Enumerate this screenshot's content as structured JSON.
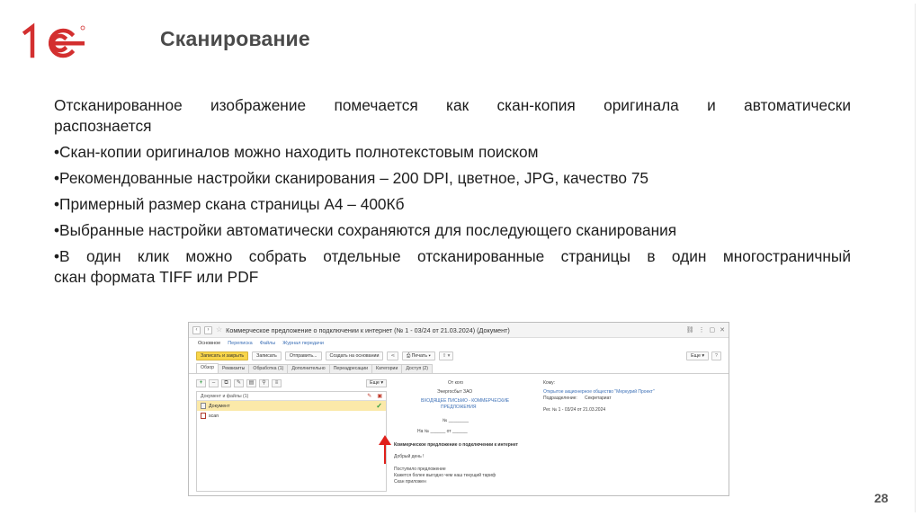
{
  "slide": {
    "title": "Сканирование",
    "page_number": "28",
    "intro": "Отсканированное изображение помечается как скан-копия оригинала и автоматически распознается",
    "intro_line1": "Отсканированное изображение помечается как скан-копия оригинала и автоматически",
    "intro_line2": "распознается",
    "bullets": [
      "•Скан-копии оригиналов можно находить полнотекстовым поиском",
      "•Рекомендованные настройки сканирования – 200 DPI, цветное, JPG, качество 75",
      "•Примерный размер скана страницы А4 – 400Кб",
      "•Выбранные настройки автоматически сохраняются для последующего сканирования"
    ],
    "last_bullet_line1": "•В один клик можно собрать отдельные отсканированные страницы в один многостраничный",
    "last_bullet_line2": "скан формата TIFF или PDF",
    "colors": {
      "title": "#4a4a4a",
      "logo_red": "#d32f2f",
      "arrow": "#e0201b",
      "primary_button": "#f8d54a"
    }
  },
  "screenshot": {
    "window_title": "Коммерческое предложение о подключении к интернет (№ 1 - 03/24 от 21.03.2024) (Документ)",
    "nav": [
      "Основное",
      "Переписка",
      "Файлы",
      "Журнал передачи"
    ],
    "toolbar": {
      "save_close": "Записать и закрыть",
      "save": "Записать",
      "send": "Отправить...",
      "create_based": "Создать на основании",
      "print": "Печать",
      "more": "Еще"
    },
    "tabs": [
      "Обзор",
      "Реквизиты",
      "Обработка (1)",
      "Дополнительно",
      "Переадресации",
      "Категории",
      "Доступ (2)"
    ],
    "file_panel": {
      "more": "Еще",
      "header": "Документ и файлы (1)",
      "rows": [
        {
          "name": "Документ",
          "selected": true
        },
        {
          "name": "scan",
          "selected": false
        }
      ]
    },
    "preview": {
      "from_label": "От кого",
      "from_value": "Энергосбыт ЗАО",
      "incoming_line1": "ВХОДЯЩЕЕ ПИСЬМО - КОММЕРЧЕСКИЕ",
      "incoming_line2": "ПРЕДЛОЖЕНИЯ",
      "no_line": "№ ________",
      "to_label": "Кому:",
      "to_value": "Открытое акционерное общество \"Меркурий Проект\"",
      "dept_label": "Подразделение:",
      "dept_value": "Секретариат",
      "ref": "Рег. № 1 - 03/24 от 21.03.2024",
      "num_date": "На № ______ от ______",
      "subject": "Коммерческое предложение о подключении к интернет",
      "greeting": "Добрый день !",
      "body1": "Поступило предложение",
      "body2": "Кажется более выгодно чем наш текущий тариф",
      "body3": "Скан приложен"
    }
  }
}
